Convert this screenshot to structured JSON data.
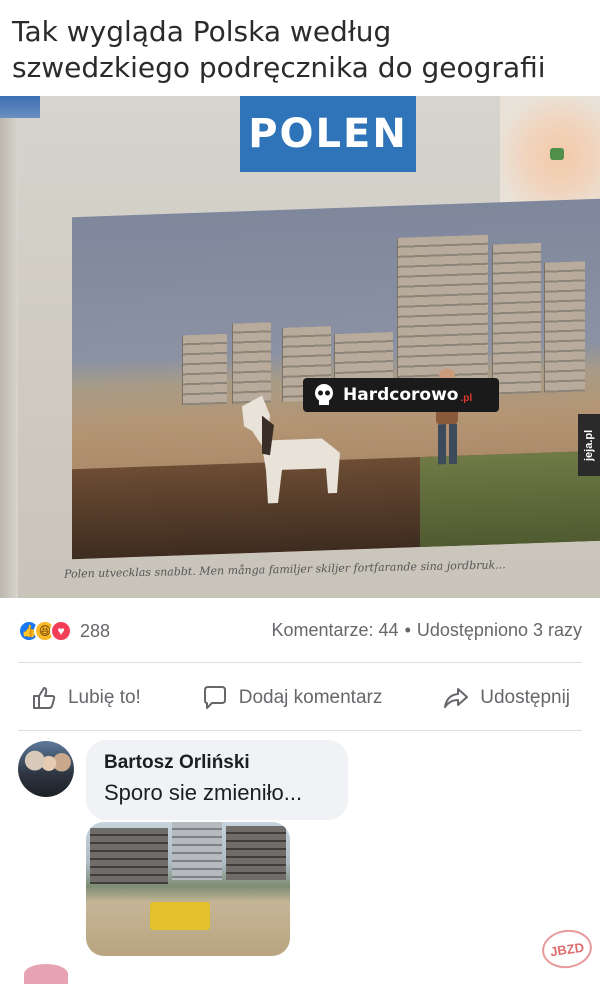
{
  "post": {
    "title_line1": "Tak wygląda Polska według",
    "title_line2": "szwedzkiego podręcznika do geografii"
  },
  "photo": {
    "banner": "POLEN",
    "watermark": "Hardcorowo",
    "watermark_suffix": ".pl",
    "side_tag": "jeja.pl",
    "book_caption": "Polen utvecklas snabbt. Men många familjer skiljer fortfarande sina jordbruk..."
  },
  "reactions": {
    "count": "288",
    "comments": "Komentarze: 44",
    "separator": "•",
    "shares": "Udostępniono 3 razy"
  },
  "actions": {
    "like": "Lubię to!",
    "comment": "Dodaj komentarz",
    "share": "Udostępnij"
  },
  "comment": {
    "author": "Bartosz Orliński",
    "text": "Sporo sie zmieniło..."
  },
  "badge": "JBZD",
  "colors": {
    "like_blue": "#1877f2",
    "haha_yellow": "#f7b928",
    "love_red": "#f33e58",
    "banner_blue": "#2f73b8",
    "meta_gray": "#65676b"
  },
  "icons": [
    "thumbs-up-icon",
    "speech-bubble-icon",
    "share-arrow-icon",
    "skull-icon"
  ]
}
